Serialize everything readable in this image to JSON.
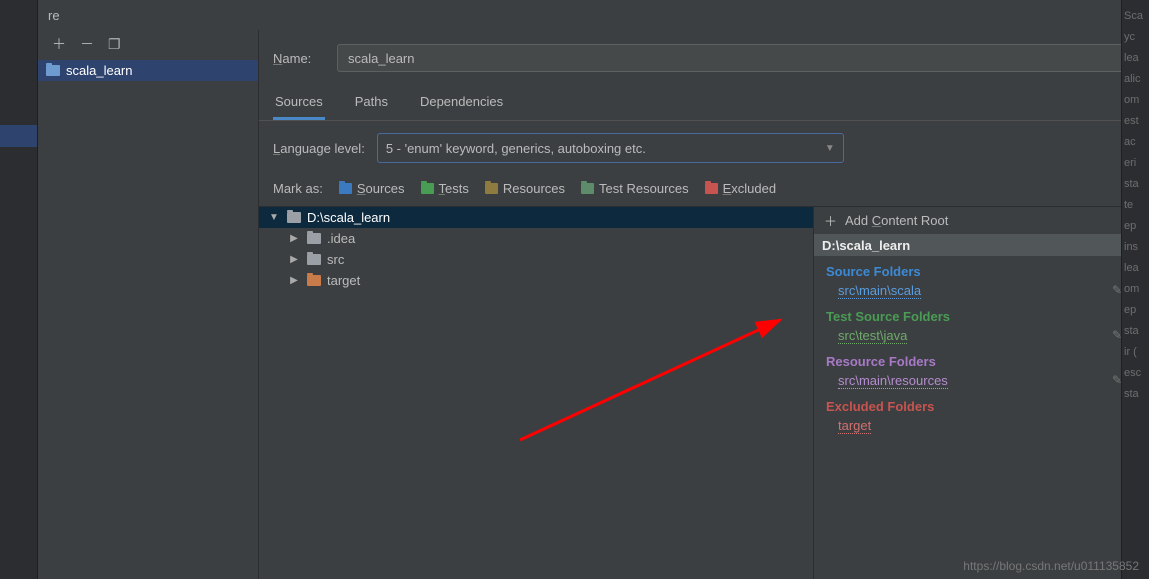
{
  "titlebar": {
    "title": "re"
  },
  "sidebar": {
    "module": "scala_learn"
  },
  "form": {
    "name_label": "Name:",
    "name_value": "scala_learn",
    "tabs": {
      "sources": "Sources",
      "paths": "Paths",
      "deps": "Dependencies"
    },
    "lang_label": "Language level:",
    "lang_value": "5 - 'enum' keyword, generics, autoboxing etc."
  },
  "markas": {
    "label": "Mark as:",
    "sources": "Sources",
    "tests": "Tests",
    "resources": "Resources",
    "test_resources": "Test Resources",
    "excluded": "Excluded"
  },
  "tree": {
    "root": "D:\\scala_learn",
    "children": [
      {
        "name": ".idea",
        "color": "gray"
      },
      {
        "name": "src",
        "color": "gray"
      },
      {
        "name": "target",
        "color": "orange"
      }
    ]
  },
  "rightpanel": {
    "add_root": "Add Content Root",
    "content_root": "D:\\scala_learn",
    "sections": {
      "source": {
        "label": "Source Folders",
        "items": [
          "src\\main\\scala"
        ]
      },
      "test": {
        "label": "Test Source Folders",
        "items": [
          "src\\test\\java"
        ]
      },
      "resource": {
        "label": "Resource Folders",
        "items": [
          "src\\main\\resources"
        ]
      },
      "excluded": {
        "label": "Excluded Folders",
        "items": [
          "target"
        ]
      }
    }
  },
  "watermark": "https://blog.csdn.net/u011135852",
  "bg_snippets": [
    "Sca",
    "",
    "",
    "yc",
    "lea",
    "alic",
    "om",
    "est",
    "ac",
    "eri",
    "sta",
    "te",
    "ep",
    "ins",
    "lea",
    "om",
    "ep",
    "sta",
    "ir (",
    "esc",
    "sta"
  ]
}
